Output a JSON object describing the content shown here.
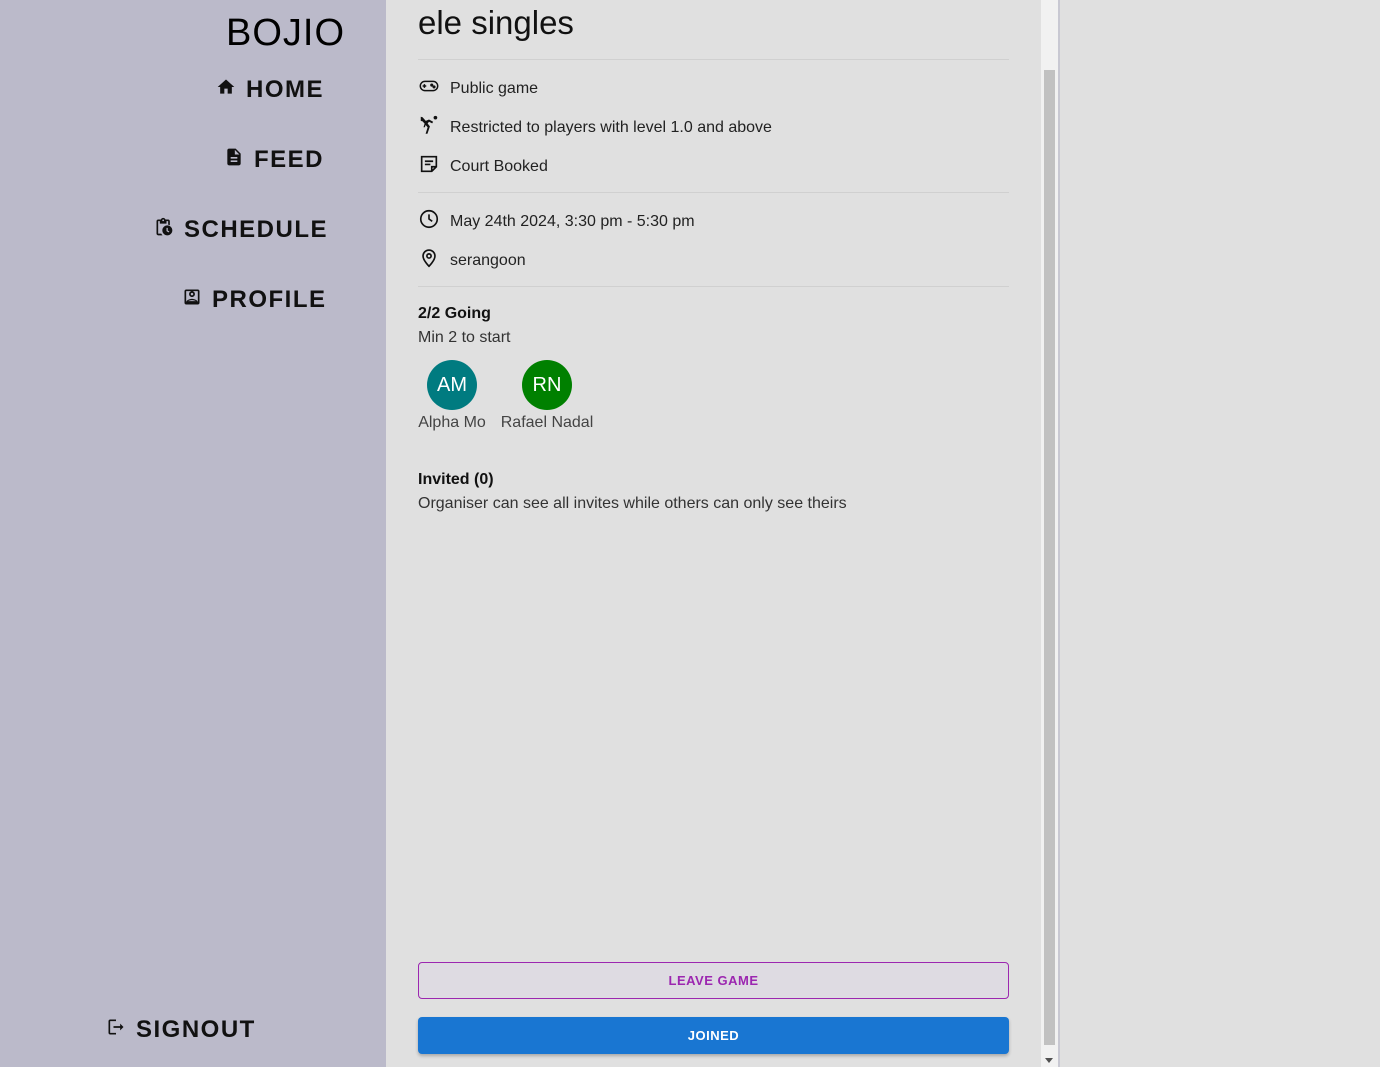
{
  "sidebar": {
    "logo": "BOJIO",
    "nav": [
      {
        "label": "HOME",
        "icon": "home-icon"
      },
      {
        "label": "FEED",
        "icon": "feed-icon"
      },
      {
        "label": "SCHEDULE",
        "icon": "schedule-icon"
      },
      {
        "label": "PROFILE",
        "icon": "profile-icon"
      }
    ],
    "signout": {
      "label": "SIGNOUT",
      "icon": "signout-icon"
    }
  },
  "game": {
    "title": "ele singles",
    "visibility": "Public game",
    "restriction": "Restricted to players with level 1.0 and above",
    "court": "Court Booked",
    "datetime": "May 24th 2024, 3:30 pm - 5:30 pm",
    "location": "serangoon",
    "going": {
      "title": "2/2 Going",
      "min": "Min 2 to start",
      "players": [
        {
          "initials": "AM",
          "name": "Alpha Mo",
          "color": "#007b80"
        },
        {
          "initials": "RN",
          "name": "Rafael Nadal",
          "color": "#008000"
        }
      ]
    },
    "invited": {
      "title": "Invited (0)",
      "note": "Organiser can see all invites while others can only see theirs"
    }
  },
  "actions": {
    "leave": "LEAVE GAME",
    "joined": "JOINED"
  },
  "colors": {
    "sidebar_bg": "#bbbaca",
    "leave_accent": "#9c27b0",
    "joined_bg": "#1976d2"
  }
}
